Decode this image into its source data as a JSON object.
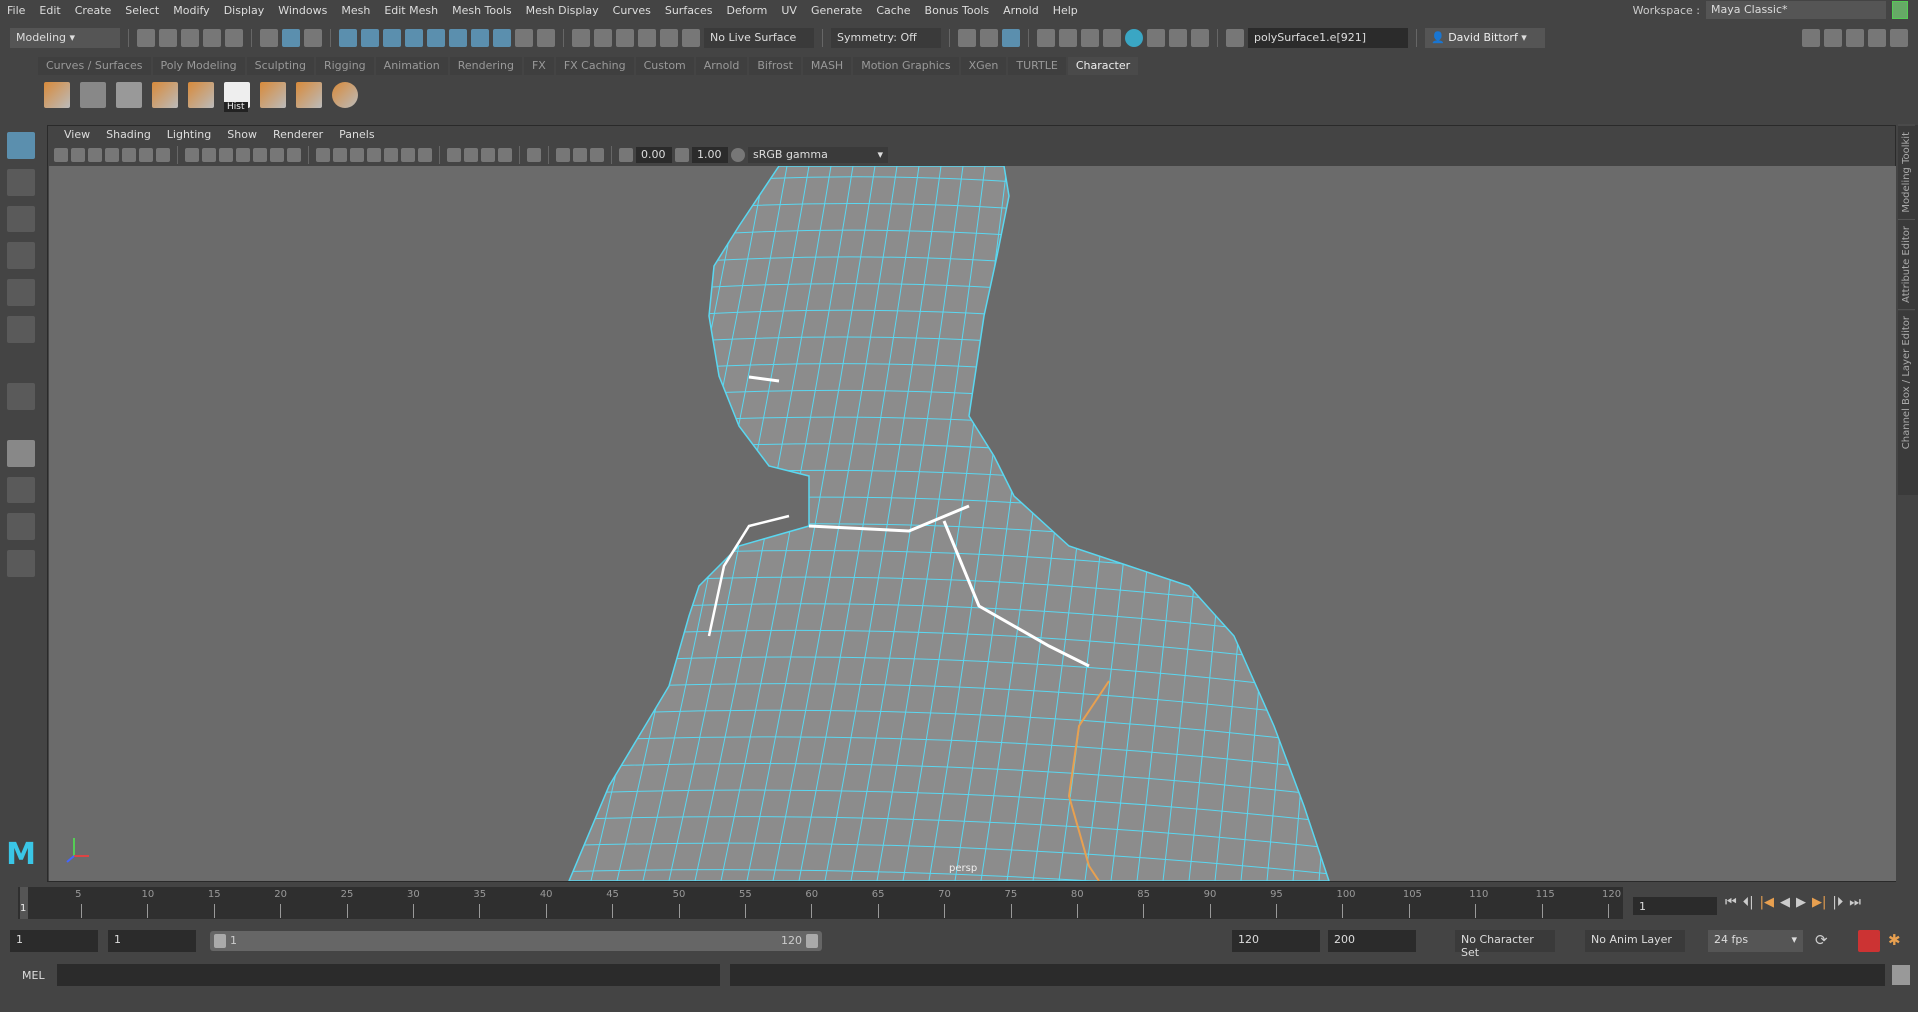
{
  "menubar": {
    "items": [
      "File",
      "Edit",
      "Create",
      "Select",
      "Modify",
      "Display",
      "Windows",
      "Mesh",
      "Edit Mesh",
      "Mesh Tools",
      "Mesh Display",
      "Curves",
      "Surfaces",
      "Deform",
      "UV",
      "Generate",
      "Cache",
      "Bonus Tools",
      "Arnold",
      "Help"
    ],
    "workspace_label": "Workspace :",
    "workspace_value": "Maya Classic*"
  },
  "toolbar": {
    "menuset": "Modeling",
    "live_surface": "No Live Surface",
    "symmetry": "Symmetry: Off",
    "selection_field": "polySurface1.e[921]",
    "user": "David Bittorf"
  },
  "shelf": {
    "tabs": [
      "Curves / Surfaces",
      "Poly Modeling",
      "Sculpting",
      "Rigging",
      "Animation",
      "Rendering",
      "FX",
      "FX Caching",
      "Custom",
      "Arnold",
      "Bifrost",
      "MASH",
      "Motion Graphics",
      "XGen",
      "TURTLE",
      "Character"
    ],
    "active": "Character",
    "hist_label": "Hist"
  },
  "panel": {
    "menus": [
      "View",
      "Shading",
      "Lighting",
      "Show",
      "Renderer",
      "Panels"
    ],
    "exposure": "0.00",
    "gamma": "1.00",
    "color_space": "sRGB gamma",
    "camera": "persp"
  },
  "right_tabs": [
    "Modeling Toolkit",
    "Attribute Editor",
    "Channel Box / Layer Editor"
  ],
  "timeline": {
    "ticks": [
      "5",
      "10",
      "15",
      "20",
      "25",
      "30",
      "35",
      "40",
      "45",
      "50",
      "55",
      "60",
      "65",
      "70",
      "75",
      "80",
      "85",
      "90",
      "95",
      "100",
      "105",
      "110",
      "115",
      "120"
    ],
    "current": "1",
    "current_frame_field": "1"
  },
  "range": {
    "start": "1",
    "anim_start": "1",
    "slider_start": "1",
    "slider_end": "120",
    "end": "120",
    "anim_end": "200",
    "character_set": "No Character Set",
    "anim_layer": "No Anim Layer",
    "fps": "24 fps"
  },
  "cmdline": {
    "label": "MEL"
  },
  "colors": {
    "wire": "#5ad7f0",
    "accent": "#5b8fae",
    "viewport": "#6b6b6b",
    "selected_edge": "#ffffff",
    "orange_edge": "#e8a050"
  }
}
